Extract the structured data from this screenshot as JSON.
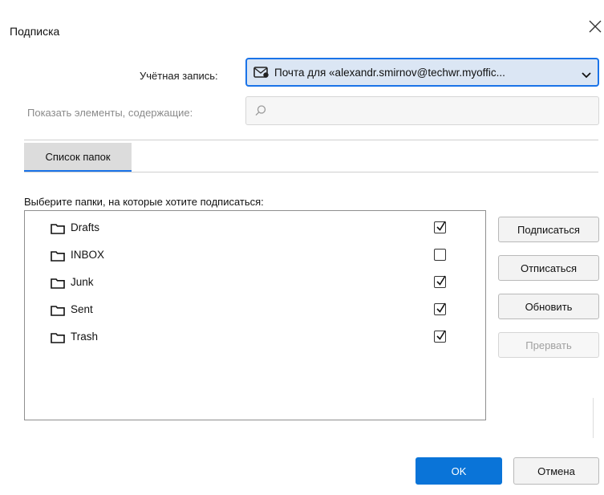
{
  "window": {
    "title": "Подписка"
  },
  "account": {
    "label": "Учётная запись:",
    "value": "Почта для «alexandr.smirnov@techwr.myoffic..."
  },
  "filter": {
    "label": "Показать элементы, содержащие:",
    "value": ""
  },
  "tabs": [
    {
      "label": "Список папок"
    }
  ],
  "list": {
    "label": "Выберите папки, на которые хотите подписаться:",
    "folders": [
      {
        "name": "Drafts",
        "checked": true
      },
      {
        "name": "INBOX",
        "checked": false
      },
      {
        "name": "Junk",
        "checked": true
      },
      {
        "name": "Sent",
        "checked": true
      },
      {
        "name": "Trash",
        "checked": true
      }
    ]
  },
  "side_buttons": {
    "subscribe": "Подписаться",
    "unsubscribe": "Отписаться",
    "refresh": "Обновить",
    "stop": "Прервать"
  },
  "footer": {
    "ok": "OK",
    "cancel": "Отмена"
  },
  "colors": {
    "accent": "#1a73e8",
    "primary_button": "#0a74d8"
  }
}
